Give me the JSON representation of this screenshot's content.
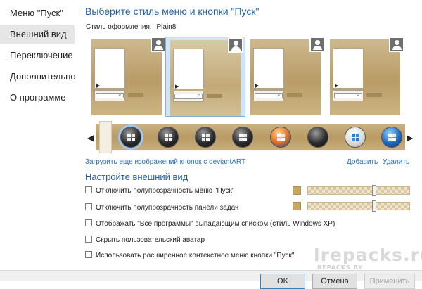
{
  "sidebar": {
    "items": [
      {
        "label": "Меню \"Пуск\"",
        "active": false
      },
      {
        "label": "Внешний вид",
        "active": true
      },
      {
        "label": "Переключение",
        "active": false
      },
      {
        "label": "Дополнительно",
        "active": false
      },
      {
        "label": "О программе",
        "active": false
      }
    ]
  },
  "main": {
    "title": "Выберите стиль меню и кнопки \"Пуск\"",
    "style_label": "Стиль оформления:",
    "style_value": "Plain8",
    "previews": [
      {
        "selected": false
      },
      {
        "selected": true
      },
      {
        "selected": false
      },
      {
        "selected": false
      }
    ],
    "orbs": [
      {
        "icon": "windows-orb-icon",
        "selected": true
      },
      {
        "icon": "windows-orb-icon",
        "selected": false
      },
      {
        "icon": "windows-orb-icon",
        "selected": false
      },
      {
        "icon": "windows-orb-icon",
        "selected": false
      },
      {
        "icon": "windows-orb-icon",
        "selected": false
      },
      {
        "icon": "windows-orb-icon",
        "selected": false
      },
      {
        "icon": "windows-orb-icon",
        "selected": false
      },
      {
        "icon": "windows-orb-icon",
        "selected": false
      }
    ],
    "links": {
      "download": "Загрузить еще изображений кнопок с deviantART",
      "add": "Добавить",
      "remove": "Удалить"
    },
    "section_title": "Настройте внешний вид",
    "options": [
      {
        "label": "Отключить полупрозрачность меню \"Пуск\"",
        "checked": false
      },
      {
        "label": "Отключить полупрозрачность панели задач",
        "checked": false
      },
      {
        "label": "Отображать \"Все программы\" выпадающим списком (стиль Windows XP)",
        "checked": false
      },
      {
        "label": "Скрыть пользовательский аватар",
        "checked": false
      },
      {
        "label": "Использовать расширенное контекстное меню кнопки \"Пуск\"",
        "checked": false
      }
    ]
  },
  "footer": {
    "ok": "OK",
    "cancel": "Отмена",
    "apply": "Применить"
  },
  "watermark": {
    "main": "lrepacks.ru",
    "sub": "REPACKS BY ELCHUPACABRA"
  },
  "colors": {
    "accent": "#1e5fa8",
    "link": "#2a6fbe",
    "theme_gold": "#b99c66"
  }
}
